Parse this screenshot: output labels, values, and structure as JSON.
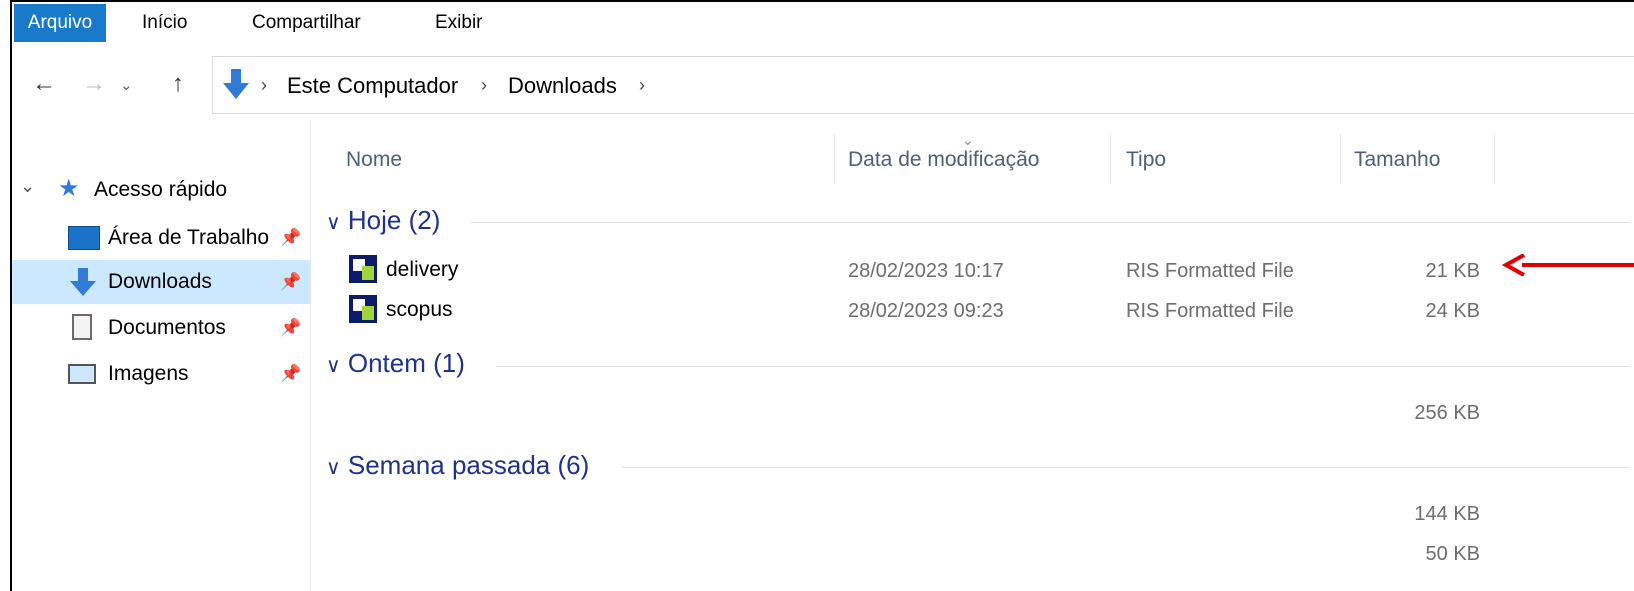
{
  "ribbon": {
    "tabs": [
      "Arquivo",
      "Início",
      "Compartilhar",
      "Exibir"
    ]
  },
  "address": {
    "crumbs": [
      "Este Computador",
      "Downloads"
    ]
  },
  "sidebar": {
    "quick_access": "Acesso rápido",
    "items": [
      {
        "label": "Área de Trabalho",
        "icon": "desktop-icon"
      },
      {
        "label": "Downloads",
        "icon": "download-arrow-icon",
        "selected": true
      },
      {
        "label": "Documentos",
        "icon": "document-icon"
      },
      {
        "label": "Imagens",
        "icon": "pictures-icon"
      }
    ]
  },
  "columns": {
    "name": "Nome",
    "date": "Data de modificação",
    "type": "Tipo",
    "size": "Tamanho"
  },
  "groups": {
    "today": "Hoje (2)",
    "yesterday": "Ontem (1)",
    "last_week": "Semana passada (6)"
  },
  "files": [
    {
      "name": "delivery",
      "date": "28/02/2023 10:17",
      "type": "RIS Formatted File",
      "size": "21 KB"
    },
    {
      "name": "scopus",
      "date": "28/02/2023 09:23",
      "type": "RIS Formatted File",
      "size": "24 KB"
    }
  ],
  "hidden_rows": {
    "yesterday_size": "256 KB",
    "week_size_1": "144 KB",
    "week_size_2": "50 KB"
  },
  "colors": {
    "accent": "#1979ca",
    "selection": "#cce8ff",
    "group": "#1e3287",
    "annotation": "#e00000"
  }
}
